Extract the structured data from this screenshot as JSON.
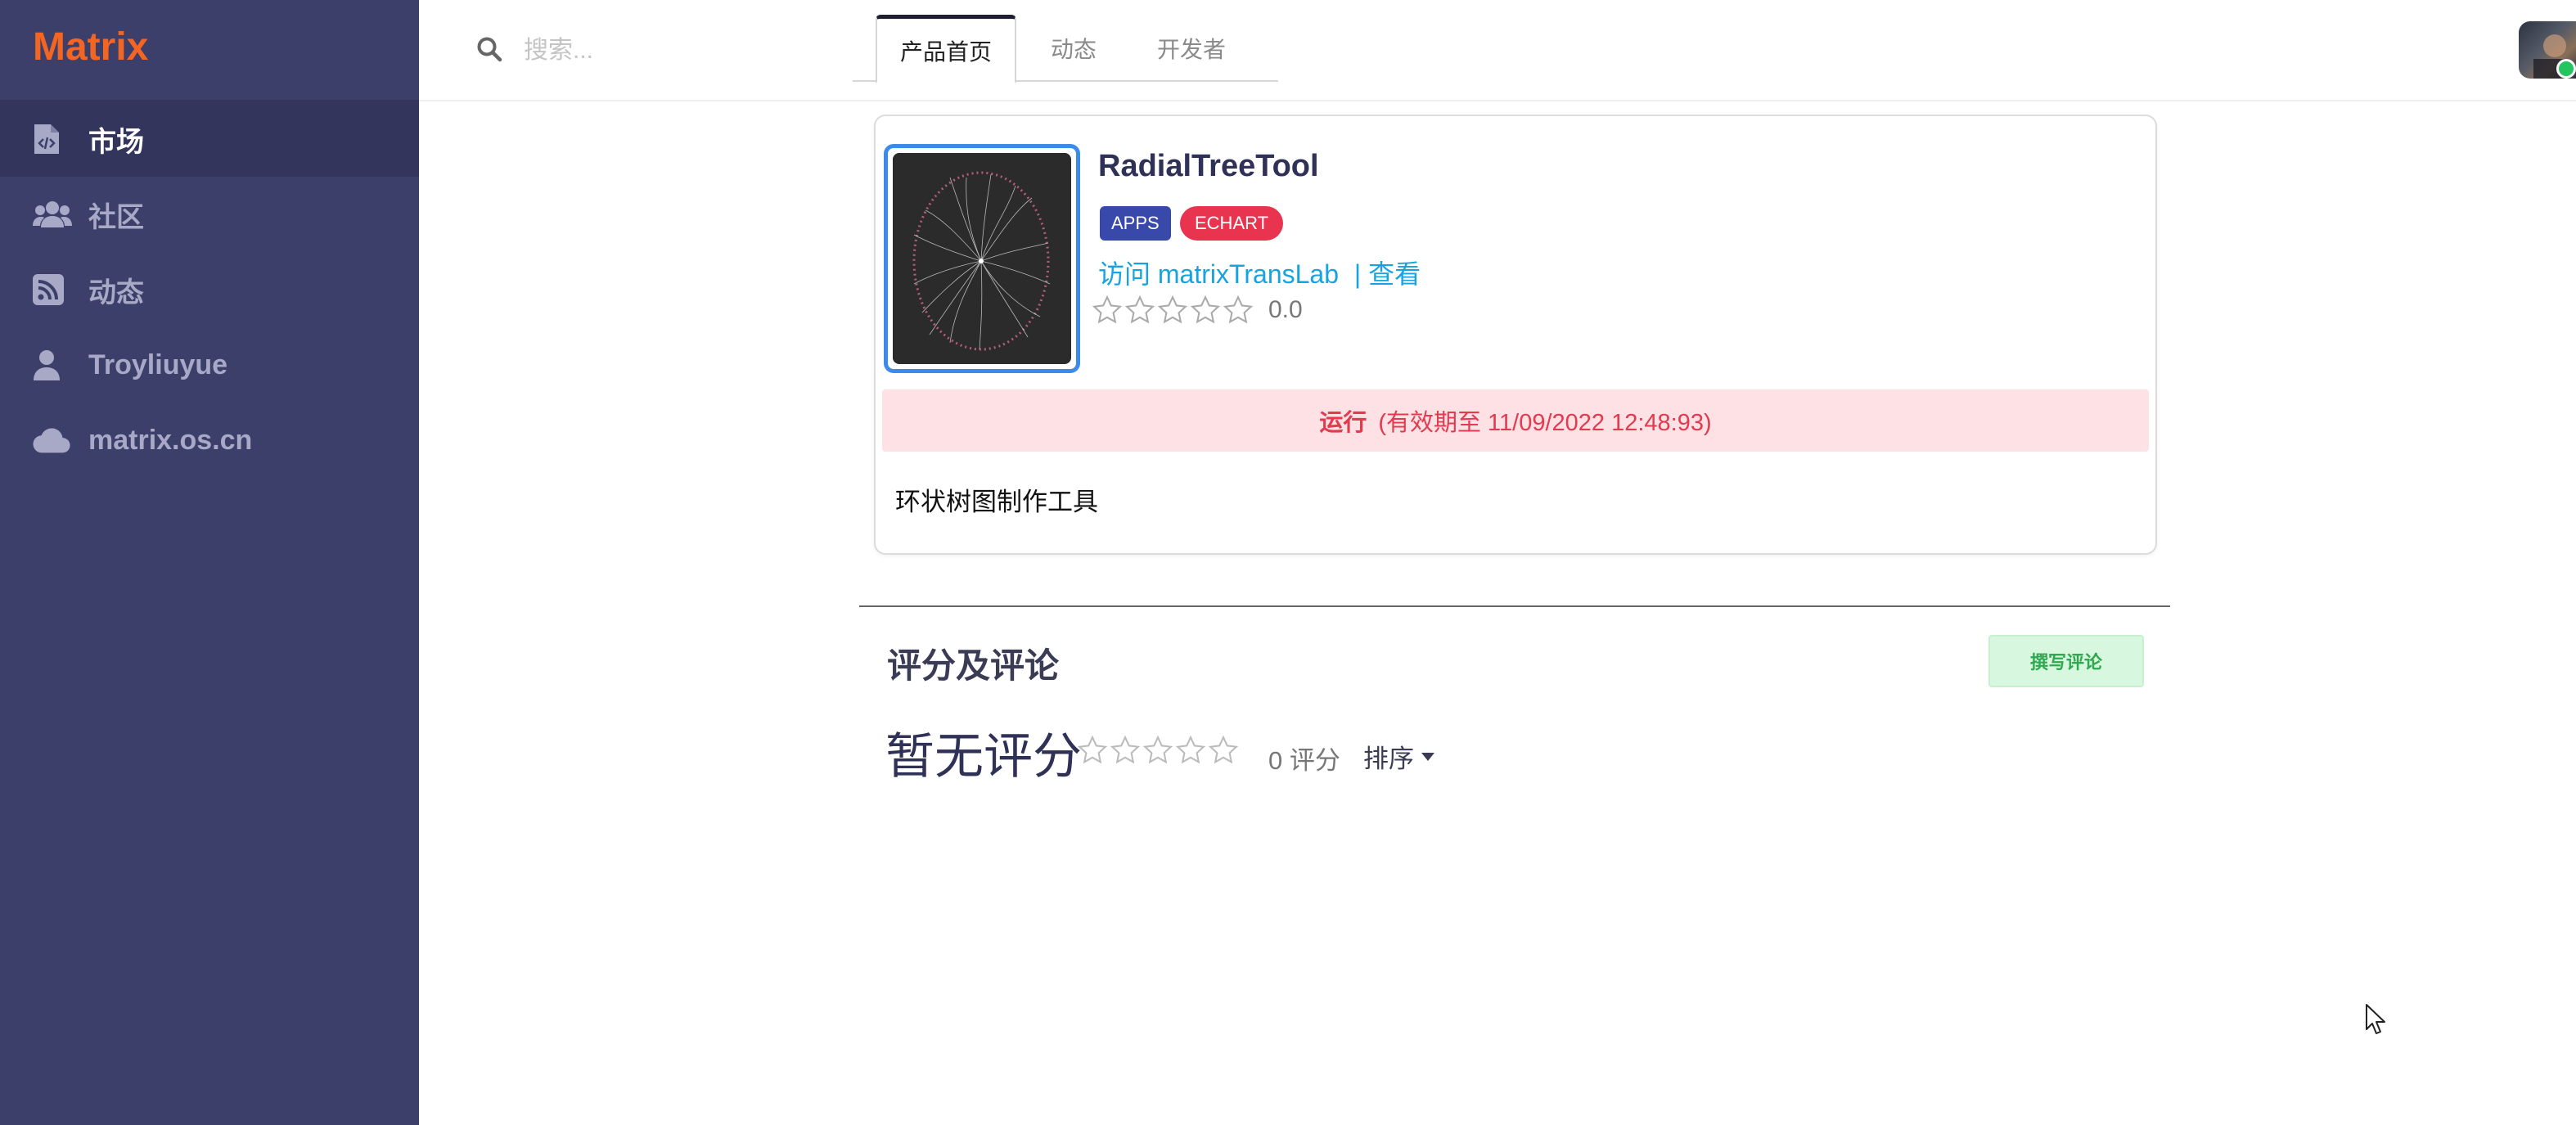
{
  "app": {
    "logo": "Matrix"
  },
  "sidebar": {
    "items": [
      {
        "label": "市场",
        "icon": "code-file-icon",
        "active": true
      },
      {
        "label": "社区",
        "icon": "users-icon",
        "active": false
      },
      {
        "label": "动态",
        "icon": "rss-icon",
        "active": false
      },
      {
        "label": "Troyliuyue",
        "icon": "user-icon",
        "active": false
      },
      {
        "label": "matrix.os.cn",
        "icon": "cloud-icon",
        "active": false
      }
    ]
  },
  "header": {
    "search_placeholder": "搜索...",
    "tabs": [
      {
        "label": "产品首页",
        "active": true
      },
      {
        "label": "动态",
        "active": false
      },
      {
        "label": "开发者",
        "active": false
      }
    ]
  },
  "product": {
    "title": "RadialTreeTool",
    "tags": [
      "APPS",
      "ECHART"
    ],
    "visit_link": "访问 matrixTransLab",
    "view_link": "| 查看",
    "rating_value": "0.0",
    "rating_stars": 0,
    "status_label": "运行",
    "status_detail": "(有效期至 11/09/2022 12:48:93)",
    "description": "环状树图制作工具"
  },
  "reviews": {
    "title": "评分及评论",
    "write_button": "撰写评论",
    "no_rating": "暂无评分",
    "count_text": "0 评分",
    "sort_label": "排序",
    "stars": 0
  },
  "colors": {
    "sidebar_bg": "#3d3f6b",
    "logo": "#f26522",
    "tag_apps": "#3949ab",
    "tag_echart": "#e8344e",
    "link": "#16a3e0",
    "status_bg": "#fde1e4",
    "status_text": "#e23a4e",
    "write_button_bg": "#d7f7de"
  }
}
